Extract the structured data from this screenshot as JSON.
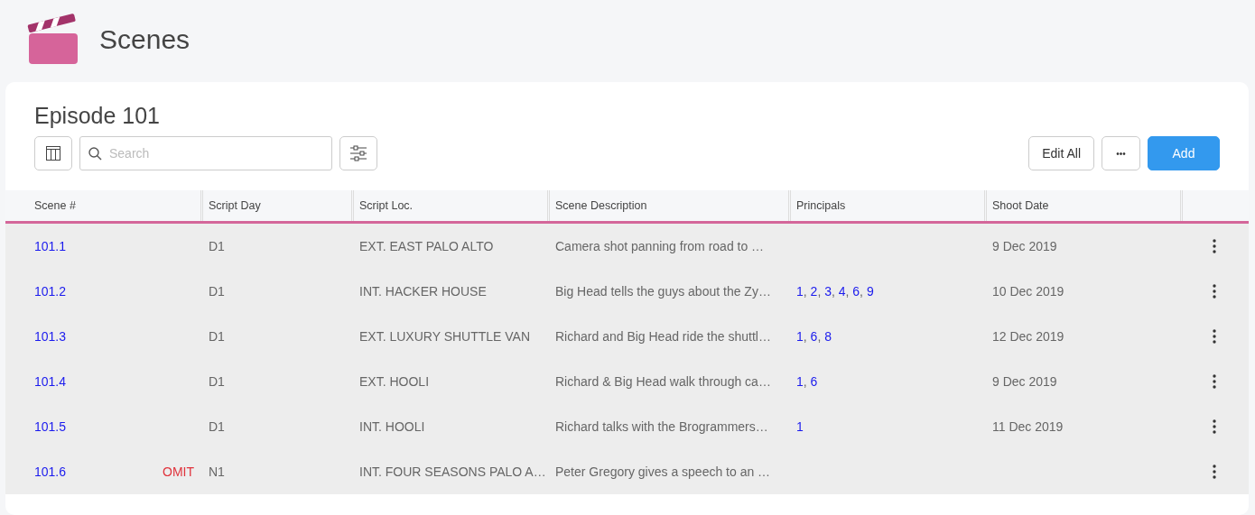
{
  "page": {
    "title": "Scenes"
  },
  "card": {
    "title": "Episode 101"
  },
  "search": {
    "placeholder": "Search"
  },
  "buttons": [
    {
      "label": "Edit All",
      "kind": "outline"
    },
    {
      "label": "•••",
      "kind": "more"
    },
    {
      "label": "Add",
      "kind": "primary"
    }
  ],
  "table": {
    "principal_separator": ",",
    "columns": [
      "Scene #",
      "Script Day",
      "Script Loc.",
      "Scene Description",
      "Principals",
      "Shoot Date"
    ],
    "rows": [
      {
        "scene": "101.1",
        "script_day": "D1",
        "script_loc": "EXT. EAST PALO ALTO",
        "description": "Camera shot panning from road to …",
        "principals": [],
        "shoot_date": "9 Dec 2019"
      },
      {
        "scene": "101.2",
        "script_day": "D1",
        "script_loc": "INT. HACKER HOUSE",
        "description": "Big Head tells the guys about the Zy…",
        "principals": [
          "1",
          "2",
          "3",
          "4",
          "6",
          "9"
        ],
        "shoot_date": "10 Dec 2019"
      },
      {
        "scene": "101.3",
        "script_day": "D1",
        "script_loc": "EXT. LUXURY SHUTTLE VAN",
        "description": "Richard and Big Head ride the shuttl…",
        "principals": [
          "1",
          "6",
          "8"
        ],
        "shoot_date": "12 Dec 2019"
      },
      {
        "scene": "101.4",
        "script_day": "D1",
        "script_loc": "EXT. HOOLI",
        "description": "Richard & Big Head walk through ca…",
        "principals": [
          "1",
          "6"
        ],
        "shoot_date": "9 Dec 2019"
      },
      {
        "scene": "101.5",
        "script_day": "D1",
        "script_loc": "INT. HOOLI",
        "description": "Richard talks with the Brogrammers…",
        "principals": [
          "1"
        ],
        "shoot_date": "11 Dec 2019"
      },
      {
        "scene": "101.6",
        "tag": "OMIT",
        "script_day": "N1",
        "script_loc": "INT. FOUR SEASONS PALO A…",
        "description": "Peter Gregory gives a speech to an …",
        "principals": []
      }
    ]
  }
}
